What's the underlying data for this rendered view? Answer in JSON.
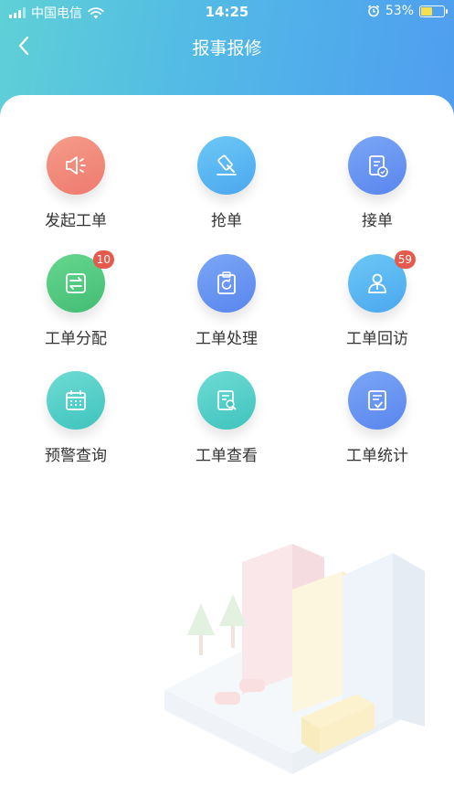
{
  "status_bar": {
    "carrier": "中国电信",
    "time": "14:25",
    "battery_percent": "53%",
    "battery_level": 0.53
  },
  "nav": {
    "title": "报事报修"
  },
  "colors": {
    "header_gradient_start": "#5fd0d6",
    "header_gradient_end": "#4f9df0",
    "badge": "#e55a4c"
  },
  "grid": {
    "items": [
      {
        "label": "发起工单",
        "icon": "megaphone-icon",
        "badge": "",
        "color_from": "#f59c8a",
        "color_to": "#ee7a6e"
      },
      {
        "label": "抢单",
        "icon": "gavel-icon",
        "badge": "",
        "color_from": "#6cc8f5",
        "color_to": "#4ba7ee"
      },
      {
        "label": "接单",
        "icon": "document-check-icon",
        "badge": "",
        "color_from": "#7aa7f6",
        "color_to": "#5a85ee"
      },
      {
        "label": "工单分配",
        "icon": "transfer-icon",
        "badge": "10",
        "color_from": "#66d68f",
        "color_to": "#43bd74"
      },
      {
        "label": "工单处理",
        "icon": "clipboard-refresh-icon",
        "badge": "",
        "color_from": "#7aa7f6",
        "color_to": "#5a85ee"
      },
      {
        "label": "工单回访",
        "icon": "user-visit-icon",
        "badge": "59",
        "color_from": "#6cc8f5",
        "color_to": "#4ba7ee"
      },
      {
        "label": "预警查询",
        "icon": "calendar-icon",
        "badge": "",
        "color_from": "#6edcd4",
        "color_to": "#3fc3bd"
      },
      {
        "label": "工单查看",
        "icon": "document-search-icon",
        "badge": "",
        "color_from": "#6edcd4",
        "color_to": "#3fc3bd"
      },
      {
        "label": "工单统计",
        "icon": "report-check-icon",
        "badge": "",
        "color_from": "#7aa7f6",
        "color_to": "#5a85ee"
      }
    ]
  }
}
